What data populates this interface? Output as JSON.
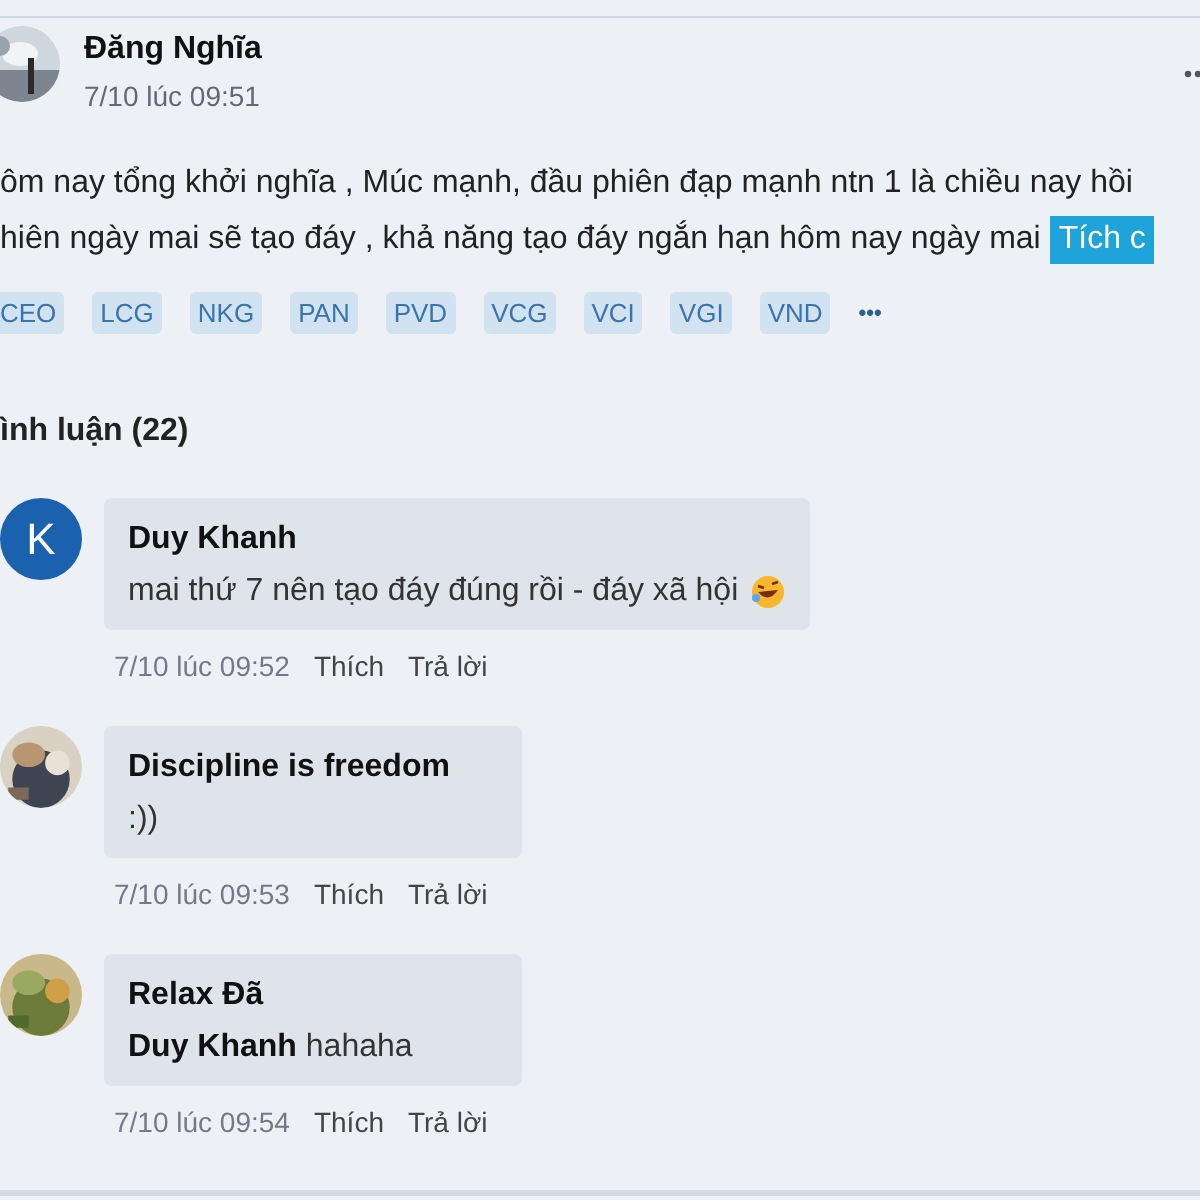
{
  "post": {
    "author": "Đăng Nghĩa",
    "time": "7/10 lúc 09:51",
    "lines": [
      {
        "text": "ôm nay tổng khởi nghĩa , Múc mạnh, đầu phiên đạp mạnh ntn 1 là chiều nay hồi"
      },
      {
        "text": "hiên ngày mai sẽ tạo đáy , khả năng tạo đáy ngắn hạn hôm nay ngày mai",
        "highlight": "Tích c"
      }
    ],
    "tags": [
      "CEO",
      "LCG",
      "NKG",
      "PAN",
      "PVD",
      "VCG",
      "VCI",
      "VGI",
      "VND"
    ],
    "more_tags": "•••"
  },
  "comments_heading": "ình luận (22)",
  "comments": [
    {
      "author": "Duy Khanh",
      "avatar": {
        "kind": "letter",
        "letter": "K"
      },
      "text": "mai thứ 7 nên tạo đáy đúng rồi - đáy xã hội",
      "emoji": true,
      "time": "7/10 lúc 09:52",
      "like": "Thích",
      "reply": "Trả lời"
    },
    {
      "author": "Discipline is freedom",
      "text": ":))",
      "emoji": false,
      "time": "7/10 lúc 09:53",
      "like": "Thích",
      "reply": "Trả lời"
    },
    {
      "author": "Relax Đã",
      "mention": "Duy Khanh",
      "text": "hahaha",
      "emoji": false,
      "time": "7/10 lúc 09:54",
      "like": "Thích",
      "reply": "Trả lời"
    }
  ]
}
